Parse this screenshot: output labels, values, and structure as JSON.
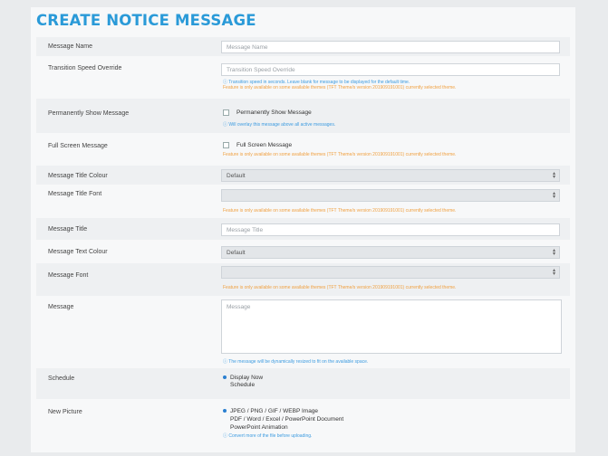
{
  "page": {
    "title": "CREATE NOTICE MESSAGE"
  },
  "fields": {
    "message_name": {
      "label": "Message Name",
      "placeholder": "Message Name"
    },
    "transition_speed": {
      "label": "Transition Speed Override",
      "placeholder": "Transition Speed Override",
      "help": "ⓘ Transition speed in seconds. Leave blank for message to be displayed for the default time.",
      "note": "Feature is only available on some available themes (TFT Theme/s version 201909191001) currently selected theme."
    },
    "permanently_show": {
      "label": "Permanently Show Message",
      "checkbox_label": "Permanently Show Message",
      "help": "ⓘ Will overlay this message above all active messages."
    },
    "full_screen": {
      "label": "Full Screen Message",
      "checkbox_label": "Full Screen Message",
      "note": "Feature is only available on some available themes (TFT Theme/s version 201909191001) currently selected theme."
    },
    "title_colour": {
      "label": "Message Title Colour",
      "value": "Default"
    },
    "title_font": {
      "label": "Message Title Font",
      "value": "",
      "note": "Feature is only available on some available themes (TFT Theme/s version 201909191001) currently selected theme."
    },
    "message_title": {
      "label": "Message Title",
      "placeholder": "Message Title"
    },
    "text_colour": {
      "label": "Message Text Colour",
      "value": "Default"
    },
    "message_font": {
      "label": "Message Font",
      "value": "",
      "note": "Feature is only available on some available themes (TFT Theme/s version 201909191001) currently selected theme."
    },
    "message": {
      "label": "Message",
      "placeholder": "Message",
      "help": "ⓘ The message will be dynamically resized to fit on the available space."
    },
    "schedule": {
      "label": "Schedule",
      "options": [
        "Display Now",
        "Schedule"
      ],
      "selected": "Display Now"
    },
    "new_picture": {
      "label": "New Picture",
      "options": [
        "JPEG / PNG / GIF / WEBP Image",
        "PDF / Word / Excel / PowerPoint Document",
        "PowerPoint Animation"
      ],
      "selected": "JPEG / PNG / GIF / WEBP Image",
      "help": "ⓘ Convert more of the file before uploading."
    }
  },
  "colors": {
    "accent": "#2a9ad8",
    "help_blue": "#3c9be0",
    "note_orange": "#f0a040"
  }
}
